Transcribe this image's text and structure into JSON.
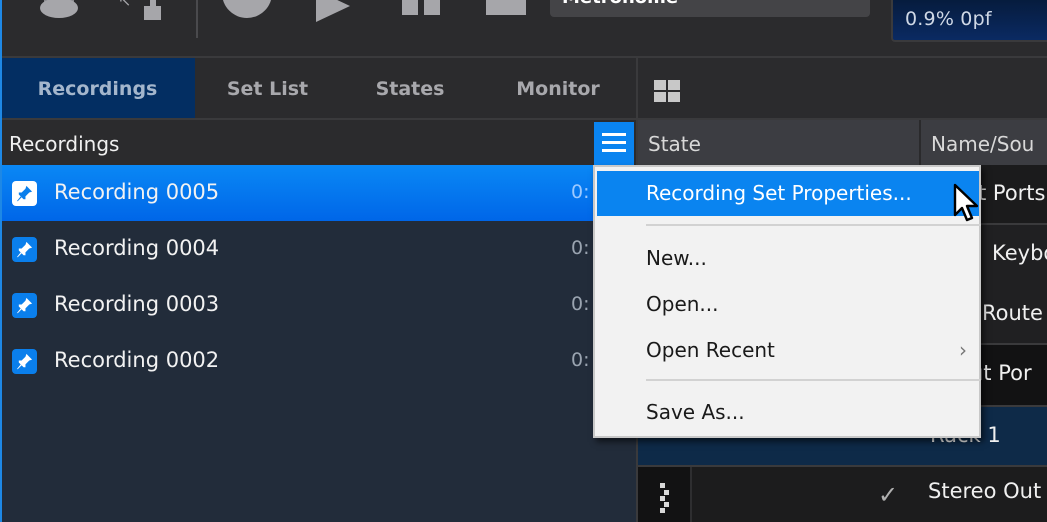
{
  "toolbar": {
    "song_field_value": "Metronome",
    "cpu_meter": "0.9%  0pf",
    "icons": [
      "metronome-icon",
      "lock-icon",
      "record-icon",
      "play-icon",
      "pause-icon",
      "stop-icon"
    ]
  },
  "left_panel": {
    "tabs": [
      {
        "label": "Recordings",
        "active": true
      },
      {
        "label": "Set List",
        "active": false
      },
      {
        "label": "States",
        "active": false
      },
      {
        "label": "Monitor",
        "active": false
      }
    ],
    "list_title": "Recordings",
    "recordings": [
      {
        "name": "Recording 0005",
        "time": "0:",
        "selected": true
      },
      {
        "name": "Recording 0004",
        "time": "0:",
        "selected": false
      },
      {
        "name": "Recording 0003",
        "time": "0:",
        "selected": false
      },
      {
        "name": "Recording 0002",
        "time": "0:",
        "selected": false
      }
    ]
  },
  "right_panel": {
    "columns": {
      "state": "State",
      "name": "Name/Sou"
    },
    "rows": [
      {
        "text": "t Ports"
      },
      {
        "text": "Keybo"
      },
      {
        "text": "Route"
      },
      {
        "text": "ut Por"
      },
      {
        "text": "Rack 1"
      },
      {
        "text": "Stereo Out",
        "checked": true
      }
    ]
  },
  "context_menu": {
    "items": {
      "properties": "Recording Set Properties...",
      "new": "New...",
      "open": "Open...",
      "open_recent": "Open Recent",
      "save_as": "Save As..."
    },
    "submenu_arrow": "›"
  },
  "colors": {
    "accent": "#0a84f0",
    "active_tab": "#032e62",
    "list_bg": "#222c3a"
  }
}
